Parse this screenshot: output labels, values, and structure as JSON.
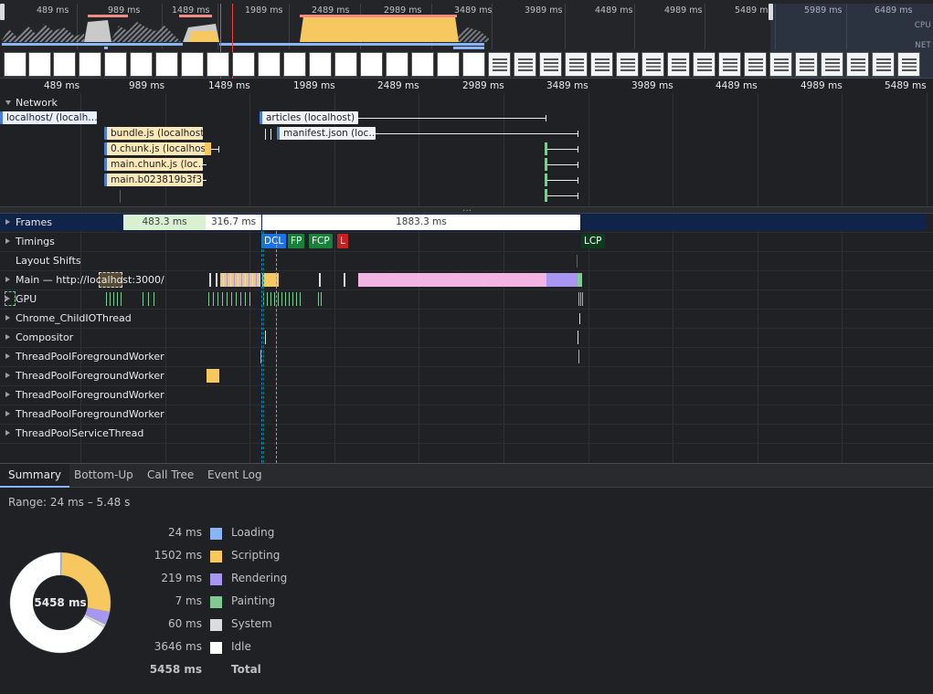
{
  "overview": {
    "ticks": [
      "489 ms",
      "989 ms",
      "1489 ms",
      "1989 ms",
      "2489 ms",
      "2989 ms",
      "3489 ms",
      "3989 ms",
      "4489 ms",
      "4989 ms",
      "5489 ms",
      "5989 ms",
      "6489 ms"
    ],
    "cpu_label": "CPU",
    "net_label": "NET"
  },
  "ruler": {
    "ticks": [
      "489 ms",
      "989 ms",
      "1489 ms",
      "1989 ms",
      "2489 ms",
      "2989 ms",
      "3489 ms",
      "3989 ms",
      "4489 ms",
      "4989 ms",
      "5489 ms"
    ]
  },
  "network": {
    "title": "Network",
    "requests": [
      {
        "label": "localhost/ (localh…"
      },
      {
        "label": "bundle.js (localhost)"
      },
      {
        "label": "0.chunk.js (localhost)"
      },
      {
        "label": "main.chunk.js (loc…"
      },
      {
        "label": "main.b023819b3f3…"
      },
      {
        "label": "articles (localhost)"
      },
      {
        "label": "manifest.json (loc…"
      }
    ]
  },
  "tracks": {
    "frames": {
      "label": "Frames",
      "values": [
        "483.3 ms",
        "316.7 ms",
        "1883.3 ms"
      ]
    },
    "timings": {
      "label": "Timings",
      "markers": [
        "DCL",
        "FP",
        "FCP",
        "L",
        "LCP"
      ]
    },
    "layout_shifts": {
      "label": "Layout Shifts"
    },
    "main": {
      "label": "Main — http://localhost:3000/"
    },
    "gpu": {
      "label": "GPU"
    },
    "child_io": {
      "label": "Chrome_ChildIOThread"
    },
    "compositor": {
      "label": "Compositor"
    },
    "workers": [
      "ThreadPoolForegroundWorker",
      "ThreadPoolForegroundWorker",
      "ThreadPoolForegroundWorker",
      "ThreadPoolForegroundWorker"
    ],
    "service": {
      "label": "ThreadPoolServiceThread"
    }
  },
  "bottom_panel": {
    "tabs": [
      "Summary",
      "Bottom-Up",
      "Call Tree",
      "Event Log"
    ],
    "active_tab": "Summary",
    "range": "Range: 24 ms – 5.48 s",
    "total_center": "5458 ms",
    "summary": [
      {
        "value": "24 ms",
        "name": "Loading",
        "ms": 24,
        "color": "#8ab4f8"
      },
      {
        "value": "1502 ms",
        "name": "Scripting",
        "ms": 1502,
        "color": "#f6c85f"
      },
      {
        "value": "219 ms",
        "name": "Rendering",
        "ms": 219,
        "color": "#a996f2"
      },
      {
        "value": "7 ms",
        "name": "Painting",
        "ms": 7,
        "color": "#81c995"
      },
      {
        "value": "60 ms",
        "name": "System",
        "ms": 60,
        "color": "#dadce0"
      },
      {
        "value": "3646 ms",
        "name": "Idle",
        "ms": 3646,
        "color": "#ffffff"
      }
    ],
    "total": {
      "value": "5458 ms",
      "name": "Total"
    }
  }
}
